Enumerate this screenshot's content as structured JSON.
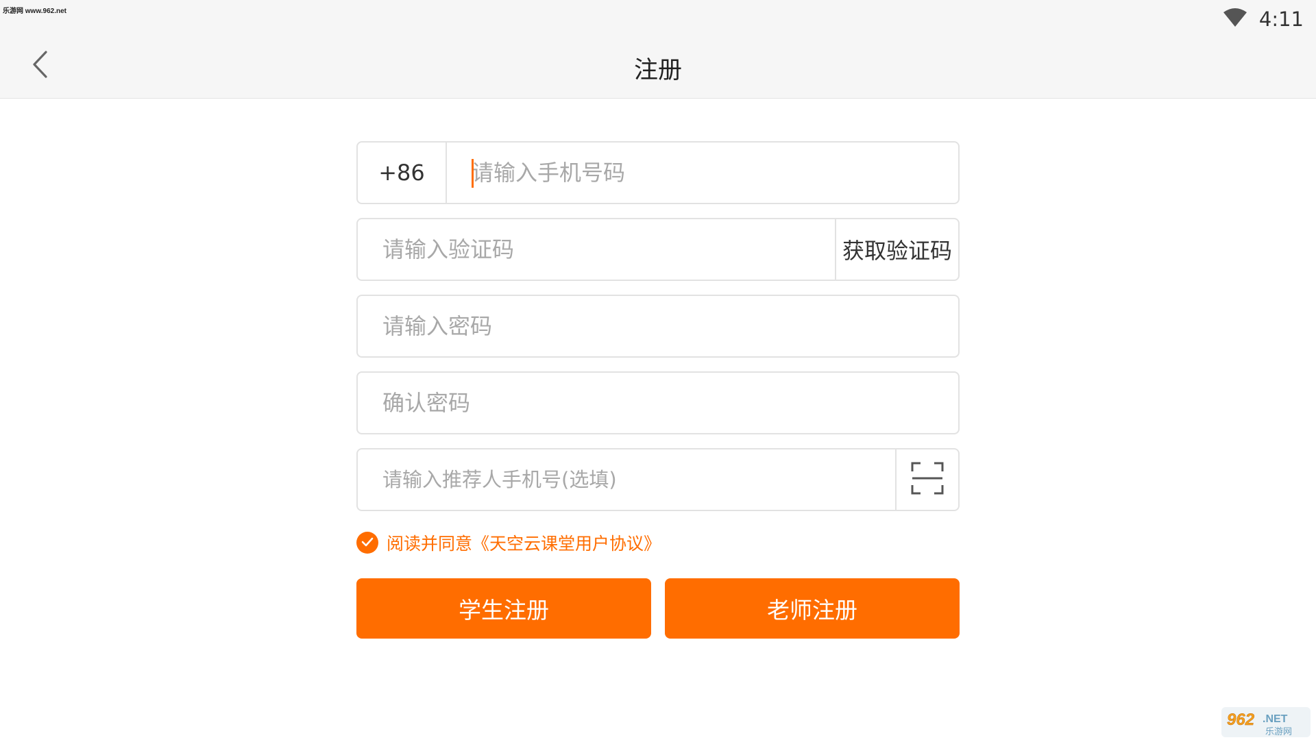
{
  "watermark": {
    "text": "乐游网 www.962.net"
  },
  "status_bar": {
    "time": "4:11",
    "wifi_icon": "wifi-icon"
  },
  "header": {
    "title": "注册",
    "back_icon": "chevron-left-icon"
  },
  "form": {
    "phone": {
      "prefix": "+86",
      "placeholder": "请输入手机号码"
    },
    "code": {
      "placeholder": "请输入验证码",
      "button_label": "获取验证码"
    },
    "password": {
      "placeholder": "请输入密码"
    },
    "confirm": {
      "placeholder": "确认密码"
    },
    "referrer": {
      "placeholder": "请输入推荐人手机号(选填)",
      "scan_icon": "scan-icon"
    }
  },
  "agreement": {
    "text": "阅读并同意《天空云课堂用户协议》",
    "checked": true
  },
  "buttons": {
    "student": "学生注册",
    "teacher": "老师注册"
  },
  "logo": {
    "text_main": "962.NET",
    "text_sub": "乐游网"
  },
  "colors": {
    "accent": "#ff6d00",
    "header_bg": "#f6f6f6",
    "border": "#e2e2e2"
  }
}
